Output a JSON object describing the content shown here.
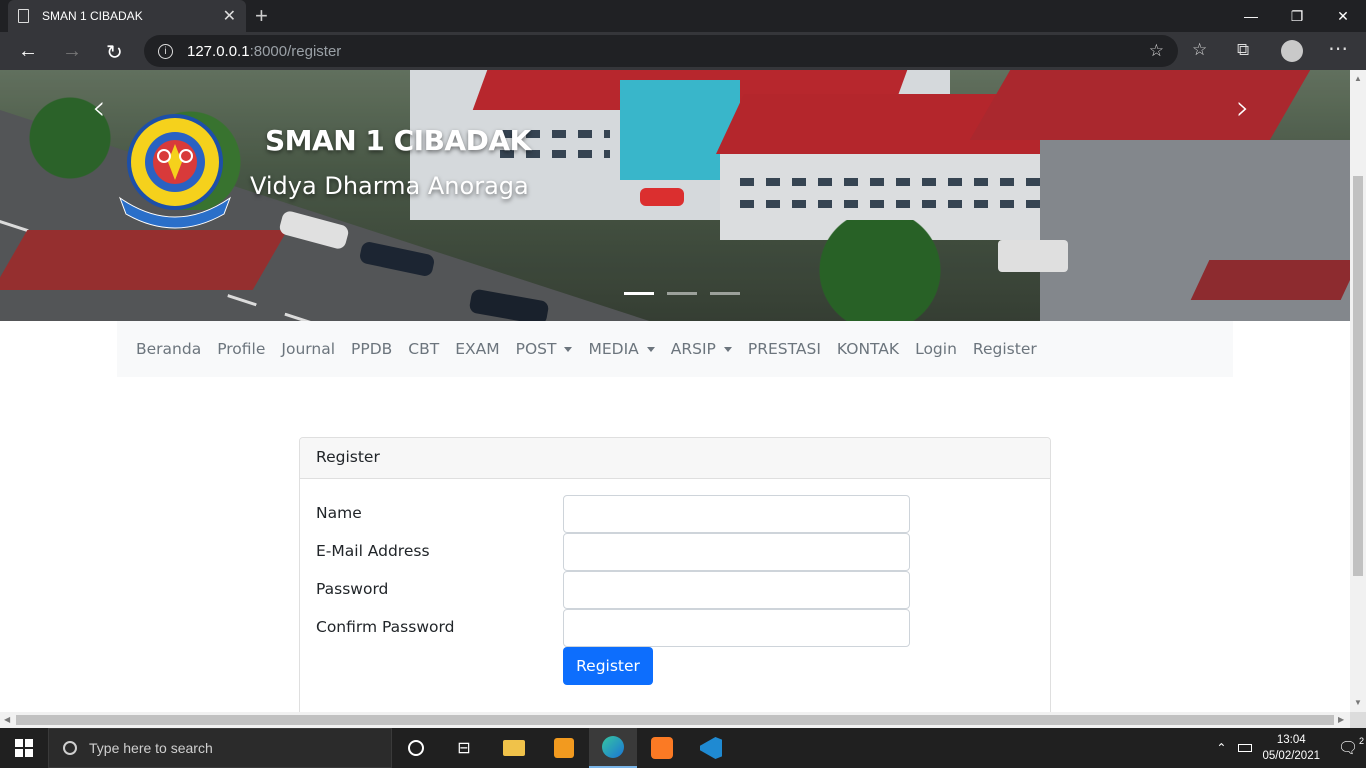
{
  "browser": {
    "tab_title": "SMAN 1 CIBADAK",
    "url_host": "127.0.0.1",
    "url_rest": ":8000/register"
  },
  "hero": {
    "title": "SMAN 1 CIBADAK",
    "subtitle": "Vidya Dharma Anoraga",
    "slides": 3,
    "active_slide": 1
  },
  "nav": {
    "items": [
      {
        "label": "Beranda",
        "dropdown": false
      },
      {
        "label": "Profile",
        "dropdown": false
      },
      {
        "label": "Journal",
        "dropdown": false
      },
      {
        "label": "PPDB",
        "dropdown": false
      },
      {
        "label": "CBT",
        "dropdown": false
      },
      {
        "label": "EXAM",
        "dropdown": false
      },
      {
        "label": "POST",
        "dropdown": true
      },
      {
        "label": "MEDIA",
        "dropdown": true
      },
      {
        "label": "ARSIP",
        "dropdown": true
      },
      {
        "label": "PRESTASI",
        "dropdown": false
      },
      {
        "label": "KONTAK",
        "dropdown": false
      },
      {
        "label": "Login",
        "dropdown": false
      },
      {
        "label": "Register",
        "dropdown": false
      }
    ]
  },
  "form": {
    "header": "Register",
    "name_label": "Name",
    "name_value": "",
    "email_label": "E-Mail Address",
    "email_value": "",
    "password_label": "Password",
    "password_value": "",
    "confirm_label": "Confirm Password",
    "confirm_value": "",
    "submit_label": "Register"
  },
  "taskbar": {
    "search_placeholder": "Type here to search",
    "time": "13:04",
    "date": "05/02/2021",
    "notifications": "2"
  },
  "colors": {
    "primary_button": "#0d6efd",
    "nav_bg": "#f8f9fa",
    "nav_text": "#6c757d"
  }
}
